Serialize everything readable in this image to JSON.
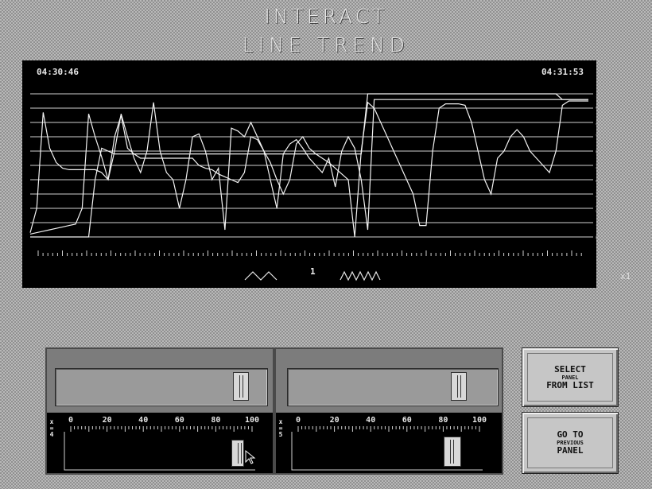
{
  "title": {
    "line1": "INTERACT",
    "line2": "LINE  TREND"
  },
  "chart": {
    "time_start": "04:30:46",
    "time_end": "04:31:53",
    "scale_label": "1",
    "zoom": "x1",
    "y_ticks": [
      "100",
      "90",
      "80",
      "70",
      "60",
      "50",
      "40",
      "30",
      "20",
      "10",
      "0"
    ]
  },
  "chart_data": {
    "type": "line",
    "x_range": [
      "04:30:46",
      "04:31:53"
    ],
    "ylim": [
      0,
      100
    ],
    "grid": true,
    "series": [
      {
        "values": [
          3,
          20,
          87,
          62,
          52,
          48,
          47,
          47,
          47,
          47,
          47,
          45,
          40,
          70,
          85,
          62,
          58,
          55,
          55,
          55,
          55,
          55,
          55,
          55,
          55,
          55,
          50,
          48,
          47,
          44,
          42,
          40,
          38,
          45,
          70,
          68,
          60,
          52,
          40,
          30,
          40,
          65,
          70,
          62,
          58,
          55,
          52,
          48,
          44,
          40,
          0,
          60,
          94,
          90,
          80,
          70,
          60,
          50,
          40,
          30,
          8,
          8,
          60,
          90,
          93,
          93,
          93,
          92,
          80,
          60,
          40,
          30,
          55,
          60,
          70,
          75,
          70,
          60,
          55,
          50,
          45,
          60,
          92,
          95,
          95,
          95,
          95
        ]
      },
      {
        "values": [
          0,
          0,
          0,
          0,
          0,
          0,
          0,
          0,
          0,
          0,
          40,
          62,
          60,
          58,
          58,
          58,
          58,
          58,
          58,
          58,
          58,
          58,
          58,
          58,
          58,
          58,
          58,
          58,
          58,
          58,
          58,
          58,
          58,
          58,
          58,
          58,
          58,
          58,
          58,
          58,
          58,
          58,
          58,
          58,
          58,
          58,
          58,
          58,
          58,
          58,
          58,
          58,
          100,
          100,
          100,
          100,
          100,
          100,
          100,
          100,
          100,
          100,
          100,
          100,
          100,
          100,
          100,
          100,
          100,
          100,
          100,
          100,
          100,
          100,
          100,
          100,
          100,
          100,
          100,
          100,
          100,
          100,
          96,
          96,
          96,
          96,
          96
        ]
      },
      {
        "values": [
          2,
          3,
          4,
          5,
          6,
          7,
          8,
          9,
          20,
          86,
          70,
          56,
          40,
          60,
          86,
          70,
          55,
          45,
          60,
          94,
          60,
          45,
          40,
          20,
          40,
          70,
          72,
          60,
          40,
          48,
          5,
          76,
          74,
          70,
          80,
          70,
          60,
          40,
          20,
          58,
          65,
          68,
          62,
          55,
          50,
          45,
          55,
          35,
          60,
          70,
          62,
          40,
          5,
          96,
          96,
          96,
          96,
          96,
          96,
          96,
          96,
          96,
          96,
          96,
          96,
          96,
          96,
          96,
          96,
          96,
          96,
          96,
          96,
          96,
          96,
          96,
          96,
          96,
          96,
          96,
          96,
          96,
          96,
          96,
          96,
          96,
          96
        ]
      }
    ]
  },
  "slider_left": {
    "label": "x=4",
    "scale": [
      "0",
      "20",
      "40",
      "60",
      "80",
      "100"
    ],
    "value_percent": 92
  },
  "slider_right": {
    "label": "x=5",
    "scale": [
      "0",
      "20",
      "40",
      "60",
      "80",
      "100"
    ],
    "value_percent": 85
  },
  "buttons": {
    "select_panel": {
      "line1": "SELECT",
      "line2": "PANEL",
      "line3": "FROM LIST"
    },
    "previous_panel": {
      "line1": "GO TO",
      "line2": "PREVIOUS",
      "line3": "PANEL"
    }
  }
}
